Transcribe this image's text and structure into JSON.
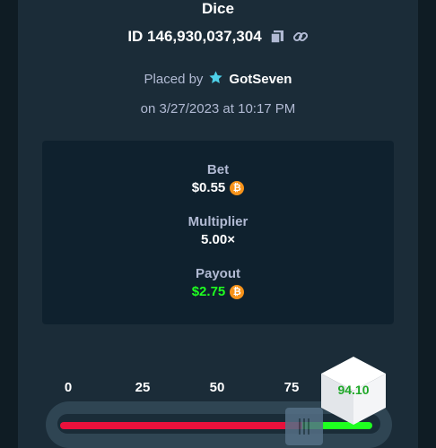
{
  "game": {
    "title": "Dice"
  },
  "bet": {
    "id_text": "ID 146,930,037,304",
    "placed_prefix": "Placed by",
    "username": "GotSeven",
    "date": "on 3/27/2023 at 10:17 PM"
  },
  "details": {
    "bet_label": "Bet",
    "bet_value": "$0.55",
    "multiplier_label": "Multiplier",
    "multiplier_value": "5.00×",
    "payout_label": "Payout",
    "payout_value": "$2.75",
    "currency_icon": "bitcoin-icon"
  },
  "dice": {
    "ticks": [
      "0",
      "25",
      "50",
      "75"
    ],
    "result": "94.10",
    "target_percent": 80,
    "result_percent": 94.1
  },
  "colors": {
    "loss": "#e9113c",
    "win": "#1fff20",
    "background": "#0f212e"
  }
}
